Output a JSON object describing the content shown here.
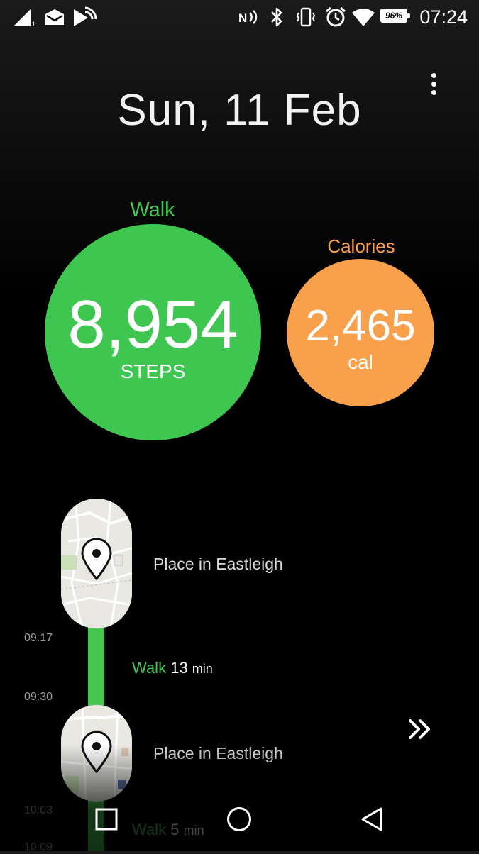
{
  "status_bar": {
    "time": "07:24",
    "battery": "96%",
    "icons": [
      "signal-icon",
      "mail-icon",
      "cast-icon",
      "nfc-icon",
      "bluetooth-icon",
      "vibrate-icon",
      "alarm-icon",
      "wifi-icon",
      "battery-icon"
    ]
  },
  "header": {
    "date": "Sun, 11 Feb",
    "menu_icon": "more-vert-icon"
  },
  "walk": {
    "label": "Walk",
    "value": "8,954",
    "unit": "STEPS",
    "color": "#3fc651"
  },
  "calories": {
    "label": "Calories",
    "value": "2,465",
    "unit": "cal",
    "color": "#f9a04c"
  },
  "timeline": {
    "places": [
      {
        "name": "Place in Eastleigh",
        "icon": "location-pin-icon"
      },
      {
        "name": "Place in Eastleigh",
        "icon": "location-pin-icon"
      }
    ],
    "times": [
      "09:17",
      "09:30",
      "10:03",
      "10:09"
    ],
    "segments": [
      {
        "activity": "Walk",
        "duration": "13",
        "unit": "min"
      },
      {
        "activity": "Walk",
        "duration": "5",
        "unit": "min"
      }
    ]
  },
  "nav_bar": {
    "icons": [
      "recents-icon",
      "home-icon",
      "back-icon"
    ]
  }
}
